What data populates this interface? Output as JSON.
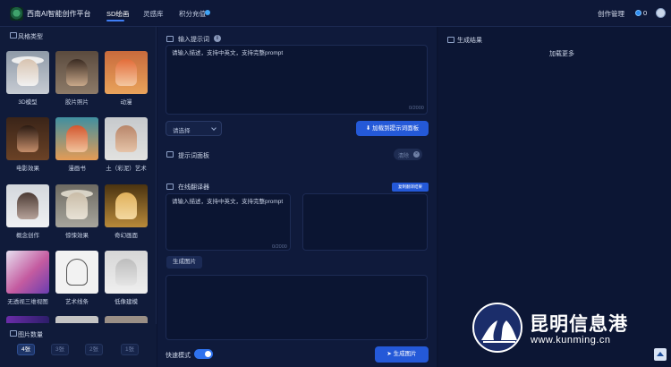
{
  "header": {
    "app_title": "西南AI智能创作平台",
    "nav": [
      {
        "label": "SD绘画"
      },
      {
        "label": "灵感库"
      },
      {
        "label": "积分充值"
      }
    ],
    "right_link": "创作管理",
    "coin_count": "0"
  },
  "left": {
    "style_title": "风格类型",
    "styles": [
      {
        "label": "3D模型"
      },
      {
        "label": "胶片照片"
      },
      {
        "label": "动漫"
      },
      {
        "label": "电影效果"
      },
      {
        "label": "漫画书"
      },
      {
        "label": "土（彩泥）艺术"
      },
      {
        "label": "概念创作"
      },
      {
        "label": "惊悚效果"
      },
      {
        "label": "奇幻画面"
      },
      {
        "label": "无透视三维视图"
      },
      {
        "label": "艺术线条"
      },
      {
        "label": "低像建模"
      }
    ],
    "count_title": "图片数量",
    "counts": [
      {
        "label": "4张",
        "active": true
      },
      {
        "label": "3张",
        "active": false
      },
      {
        "label": "2张",
        "active": false
      },
      {
        "label": "1张",
        "active": false
      }
    ]
  },
  "middle": {
    "prompt_title": "输入提示词",
    "prompt_placeholder": "请输入描述，支持中英文，支持完整prompt",
    "prompt_counter": "0/2000",
    "select_placeholder": "请选择",
    "load_button": "加载到提示词面板",
    "panel_title": "提示词面板",
    "chip_label": "清除",
    "translate_title": "在线翻译器",
    "translate_button": "复制翻译结果",
    "translate_placeholder": "请输入描述，支持中英文，支持完整prompt",
    "translate_counter": "0/2000",
    "gen_pic_button": "生成图片",
    "fast_mode_label": "快速模式",
    "generate_button": "生成图片"
  },
  "right": {
    "result_title": "生成结果",
    "load_more": "加载更多"
  },
  "watermark": {
    "title": "昆明信息港",
    "url": "www.kunming.cn"
  },
  "colors": {
    "accent": "#2459d8",
    "background": "#0b1430",
    "panel": "#0f1a3b"
  }
}
